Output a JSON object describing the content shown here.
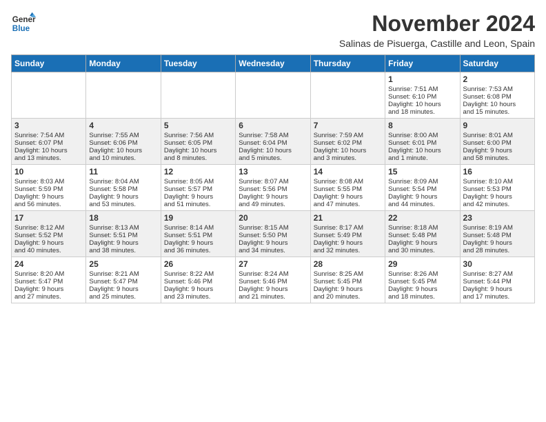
{
  "header": {
    "logo_line1": "General",
    "logo_line2": "Blue",
    "month_title": "November 2024",
    "subtitle": "Salinas de Pisuerga, Castille and Leon, Spain"
  },
  "weekdays": [
    "Sunday",
    "Monday",
    "Tuesday",
    "Wednesday",
    "Thursday",
    "Friday",
    "Saturday"
  ],
  "weeks": [
    [
      {
        "day": "",
        "info": ""
      },
      {
        "day": "",
        "info": ""
      },
      {
        "day": "",
        "info": ""
      },
      {
        "day": "",
        "info": ""
      },
      {
        "day": "",
        "info": ""
      },
      {
        "day": "1",
        "info": "Sunrise: 7:51 AM\nSunset: 6:10 PM\nDaylight: 10 hours\nand 18 minutes."
      },
      {
        "day": "2",
        "info": "Sunrise: 7:53 AM\nSunset: 6:08 PM\nDaylight: 10 hours\nand 15 minutes."
      }
    ],
    [
      {
        "day": "3",
        "info": "Sunrise: 7:54 AM\nSunset: 6:07 PM\nDaylight: 10 hours\nand 13 minutes."
      },
      {
        "day": "4",
        "info": "Sunrise: 7:55 AM\nSunset: 6:06 PM\nDaylight: 10 hours\nand 10 minutes."
      },
      {
        "day": "5",
        "info": "Sunrise: 7:56 AM\nSunset: 6:05 PM\nDaylight: 10 hours\nand 8 minutes."
      },
      {
        "day": "6",
        "info": "Sunrise: 7:58 AM\nSunset: 6:04 PM\nDaylight: 10 hours\nand 5 minutes."
      },
      {
        "day": "7",
        "info": "Sunrise: 7:59 AM\nSunset: 6:02 PM\nDaylight: 10 hours\nand 3 minutes."
      },
      {
        "day": "8",
        "info": "Sunrise: 8:00 AM\nSunset: 6:01 PM\nDaylight: 10 hours\nand 1 minute."
      },
      {
        "day": "9",
        "info": "Sunrise: 8:01 AM\nSunset: 6:00 PM\nDaylight: 9 hours\nand 58 minutes."
      }
    ],
    [
      {
        "day": "10",
        "info": "Sunrise: 8:03 AM\nSunset: 5:59 PM\nDaylight: 9 hours\nand 56 minutes."
      },
      {
        "day": "11",
        "info": "Sunrise: 8:04 AM\nSunset: 5:58 PM\nDaylight: 9 hours\nand 53 minutes."
      },
      {
        "day": "12",
        "info": "Sunrise: 8:05 AM\nSunset: 5:57 PM\nDaylight: 9 hours\nand 51 minutes."
      },
      {
        "day": "13",
        "info": "Sunrise: 8:07 AM\nSunset: 5:56 PM\nDaylight: 9 hours\nand 49 minutes."
      },
      {
        "day": "14",
        "info": "Sunrise: 8:08 AM\nSunset: 5:55 PM\nDaylight: 9 hours\nand 47 minutes."
      },
      {
        "day": "15",
        "info": "Sunrise: 8:09 AM\nSunset: 5:54 PM\nDaylight: 9 hours\nand 44 minutes."
      },
      {
        "day": "16",
        "info": "Sunrise: 8:10 AM\nSunset: 5:53 PM\nDaylight: 9 hours\nand 42 minutes."
      }
    ],
    [
      {
        "day": "17",
        "info": "Sunrise: 8:12 AM\nSunset: 5:52 PM\nDaylight: 9 hours\nand 40 minutes."
      },
      {
        "day": "18",
        "info": "Sunrise: 8:13 AM\nSunset: 5:51 PM\nDaylight: 9 hours\nand 38 minutes."
      },
      {
        "day": "19",
        "info": "Sunrise: 8:14 AM\nSunset: 5:51 PM\nDaylight: 9 hours\nand 36 minutes."
      },
      {
        "day": "20",
        "info": "Sunrise: 8:15 AM\nSunset: 5:50 PM\nDaylight: 9 hours\nand 34 minutes."
      },
      {
        "day": "21",
        "info": "Sunrise: 8:17 AM\nSunset: 5:49 PM\nDaylight: 9 hours\nand 32 minutes."
      },
      {
        "day": "22",
        "info": "Sunrise: 8:18 AM\nSunset: 5:48 PM\nDaylight: 9 hours\nand 30 minutes."
      },
      {
        "day": "23",
        "info": "Sunrise: 8:19 AM\nSunset: 5:48 PM\nDaylight: 9 hours\nand 28 minutes."
      }
    ],
    [
      {
        "day": "24",
        "info": "Sunrise: 8:20 AM\nSunset: 5:47 PM\nDaylight: 9 hours\nand 27 minutes."
      },
      {
        "day": "25",
        "info": "Sunrise: 8:21 AM\nSunset: 5:47 PM\nDaylight: 9 hours\nand 25 minutes."
      },
      {
        "day": "26",
        "info": "Sunrise: 8:22 AM\nSunset: 5:46 PM\nDaylight: 9 hours\nand 23 minutes."
      },
      {
        "day": "27",
        "info": "Sunrise: 8:24 AM\nSunset: 5:46 PM\nDaylight: 9 hours\nand 21 minutes."
      },
      {
        "day": "28",
        "info": "Sunrise: 8:25 AM\nSunset: 5:45 PM\nDaylight: 9 hours\nand 20 minutes."
      },
      {
        "day": "29",
        "info": "Sunrise: 8:26 AM\nSunset: 5:45 PM\nDaylight: 9 hours\nand 18 minutes."
      },
      {
        "day": "30",
        "info": "Sunrise: 8:27 AM\nSunset: 5:44 PM\nDaylight: 9 hours\nand 17 minutes."
      }
    ]
  ]
}
